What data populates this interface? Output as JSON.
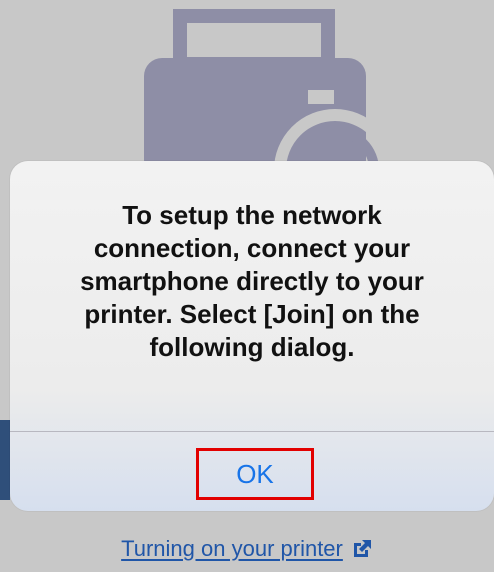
{
  "dialog": {
    "message": "To setup the network\nconnection, connect your\nsmartphone directly to your\nprinter. Select [Join] on the\nfollowing dialog.",
    "ok_label": "OK"
  },
  "footer": {
    "link_label": "Turning on your printer",
    "link_icon": "external-link-icon"
  },
  "background": {
    "illustration_icon": "printer-icon"
  },
  "colors": {
    "ok_text": "#1874e8",
    "highlight_border": "#e20000",
    "link_text": "#2056a8",
    "printer_fill": "#8e8ea6"
  }
}
